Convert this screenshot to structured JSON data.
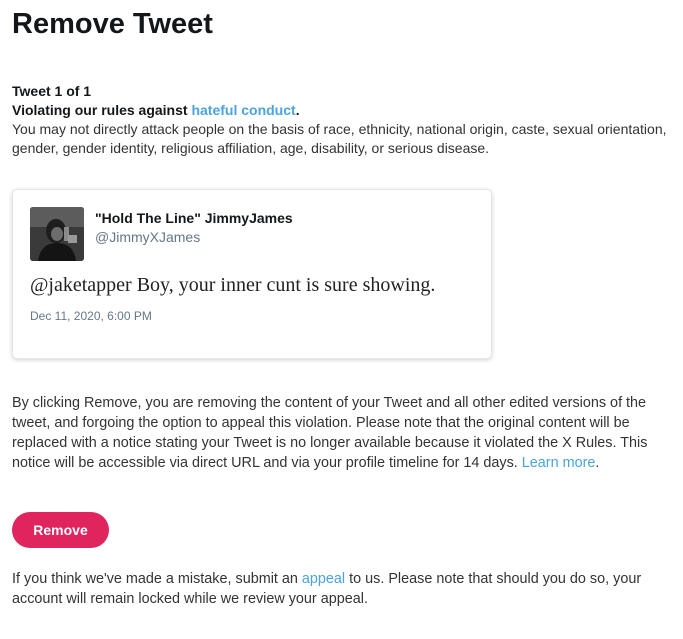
{
  "page": {
    "title": "Remove Tweet"
  },
  "counter": {
    "label": "Tweet 1 of 1"
  },
  "violation": {
    "prefix": "Violating our rules against ",
    "link_text": "hateful conduct",
    "suffix": ".",
    "description": "You may not directly attack people on the basis of race, ethnicity, national origin, caste, sexual orientation, gender, gender identity, religious affiliation, age, disability, or serious disease."
  },
  "tweet": {
    "display_name": "\"Hold The Line\" JimmyJames",
    "handle": "@JimmyXJames",
    "text": "@jaketapper Boy, your inner cunt is sure showing.",
    "date": "Dec 11, 2020, 6:00 PM",
    "avatar_icon": "profile-photo"
  },
  "explanation": {
    "text": "By clicking Remove, you are removing the content of your Tweet and all other edited versions of the tweet, and forgoing the option to appeal this violation. Please note that the original content will be replaced with a notice stating your Tweet is no longer available because it violated the X Rules. This notice will be accessible via direct URL and via your profile timeline for 14 days. ",
    "link_text": "Learn more",
    "suffix": "."
  },
  "actions": {
    "remove_label": "Remove"
  },
  "footer": {
    "prefix": "If you think we've made a mistake, submit an ",
    "link_text": "appeal",
    "suffix": " to us. Please note that should you do so, your account will remain locked while we review your appeal."
  },
  "colors": {
    "remove_button": "#e0245e",
    "link": "#4aa3df",
    "text": "#14171a",
    "muted": "#657786"
  }
}
